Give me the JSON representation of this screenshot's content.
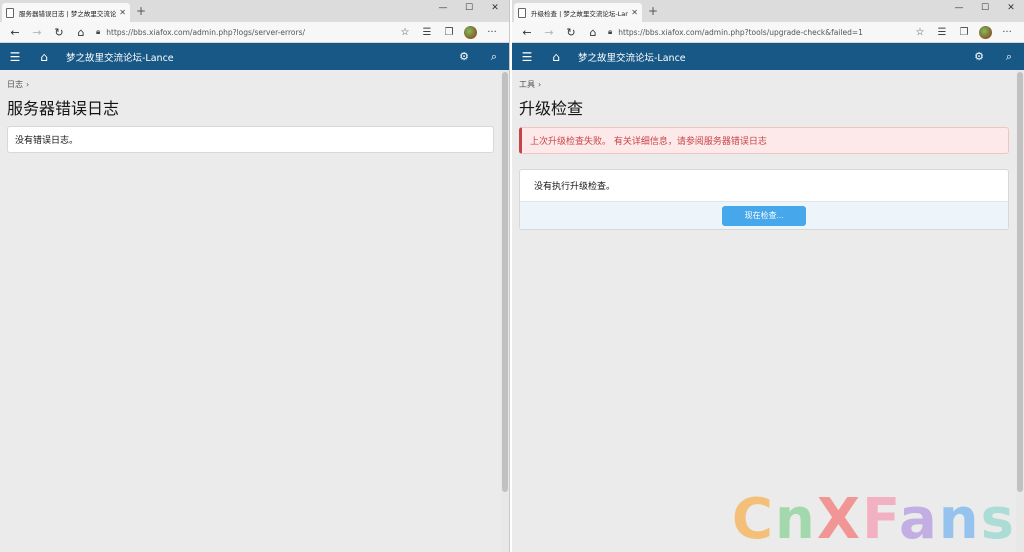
{
  "left_window": {
    "tab_title": "服务器错误日志 | 梦之故里交流论坛-Lance",
    "url": "https://bbs.xiafox.com/admin.php?logs/server-errors/",
    "site_title": "梦之故里交流论坛-Lance",
    "breadcrumb": "日志",
    "page_title": "服务器错误日志",
    "message": "没有错误日志。"
  },
  "right_window": {
    "tab_title": "升级检查 | 梦之故里交流论坛-Lance",
    "url": "https://bbs.xiafox.com/admin.php?tools/upgrade-check&failed=1",
    "site_title": "梦之故里交流论坛-Lance",
    "breadcrumb": "工具",
    "page_title": "升级检查",
    "error_message": "上次升级检查失败。 有关详细信息，请参阅服务器错误日志",
    "message": "没有执行升级检查。",
    "check_button": "现在检查..."
  },
  "watermark": "CnXFans",
  "icons": {
    "back": "arrow-left-icon",
    "forward": "arrow-right-icon",
    "refresh": "refresh-icon",
    "home": "home-icon",
    "lock": "lock-icon",
    "favorite": "star-icon",
    "collections": "collections-icon",
    "menu": "hamburger-icon",
    "admin_tools": "cogs-icon",
    "search": "search-icon"
  },
  "colors": {
    "header_bg": "#185886",
    "page_bg": "#ebebeb",
    "error_text": "#c84448",
    "error_bg": "#fde9e9",
    "button_bg": "#47a7eb"
  }
}
